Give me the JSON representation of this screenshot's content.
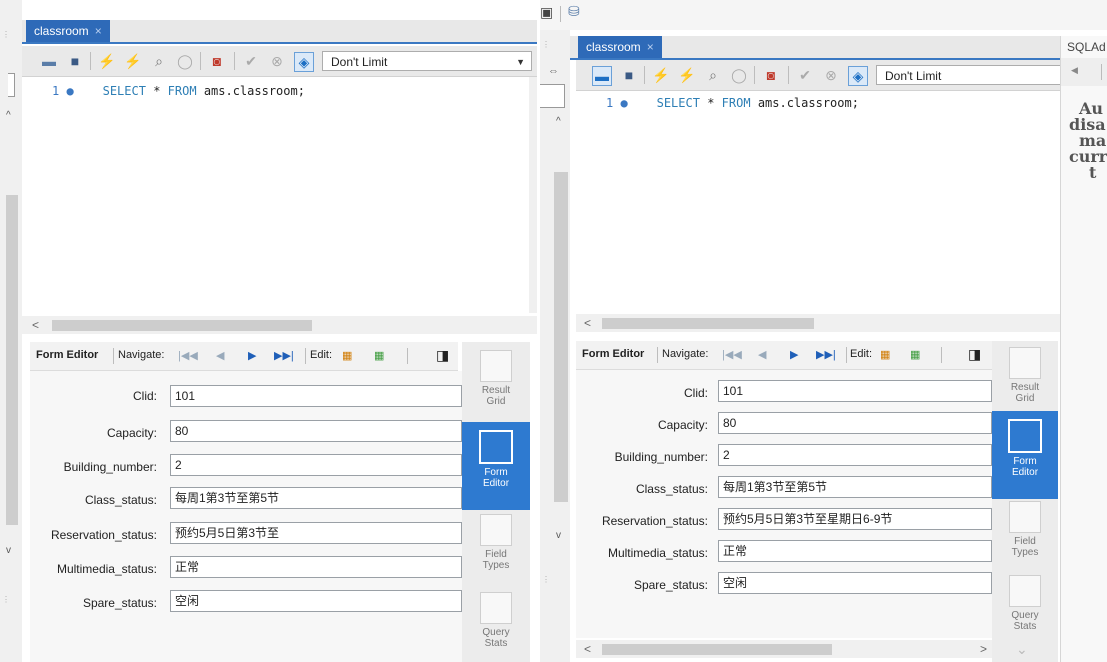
{
  "panels": [
    {
      "tab": {
        "label": "classroom",
        "close": "×"
      },
      "toolbar": {
        "limit": "Don't Limit"
      },
      "editor": {
        "line_number": "1",
        "line_dot": "●",
        "keyword1": "SELECT",
        "star": "*",
        "keyword2": "FROM",
        "table": "ams.classroom;"
      },
      "formbar": {
        "title": "Form Editor",
        "navigate": "Navigate:",
        "edit": "Edit:"
      },
      "fields": [
        {
          "label": "Clid:",
          "value": "101"
        },
        {
          "label": "Capacity:",
          "value": "80"
        },
        {
          "label": "Building_number:",
          "value": "2"
        },
        {
          "label": "Class_status:",
          "value": "每周1第3节至第5节"
        },
        {
          "label": "Reservation_status:",
          "value": "预约5月5日第3节至"
        },
        {
          "label": "Multimedia_status:",
          "value": "正常"
        },
        {
          "label": "Spare_status:",
          "value": "空闲"
        }
      ],
      "side": [
        {
          "label1": "Result",
          "label2": "Grid"
        },
        {
          "label1": "Form",
          "label2": "Editor"
        },
        {
          "label1": "Field",
          "label2": "Types"
        },
        {
          "label1": "Query",
          "label2": "Stats"
        }
      ]
    },
    {
      "tab": {
        "label": "classroom",
        "close": "×"
      },
      "toolbar": {
        "limit": "Don't Limit"
      },
      "editor": {
        "line_number": "1",
        "line_dot": "●",
        "keyword1": "SELECT",
        "star": "*",
        "keyword2": "FROM",
        "table": "ams.classroom;"
      },
      "formbar": {
        "title": "Form Editor",
        "navigate": "Navigate:",
        "edit": "Edit:"
      },
      "fields": [
        {
          "label": "Clid:",
          "value": "101"
        },
        {
          "label": "Capacity:",
          "value": "80"
        },
        {
          "label": "Building_number:",
          "value": "2"
        },
        {
          "label": "Class_status:",
          "value": "每周1第3节至第5节"
        },
        {
          "label": "Reservation_status:",
          "value": "预约5月5日第3节至星期日6-9节"
        },
        {
          "label": "Multimedia_status:",
          "value": "正常"
        },
        {
          "label": "Spare_status:",
          "value": "空闲"
        }
      ],
      "side": [
        {
          "label1": "Result",
          "label2": "Grid"
        },
        {
          "label1": "Form",
          "label2": "Editor"
        },
        {
          "label1": "Field",
          "label2": "Types"
        },
        {
          "label1": "Query",
          "label2": "Stats"
        }
      ]
    }
  ],
  "sqladd": {
    "tab": "SQLAd",
    "text": [
      "Au",
      "disa",
      "ma",
      "curr",
      "t"
    ]
  }
}
